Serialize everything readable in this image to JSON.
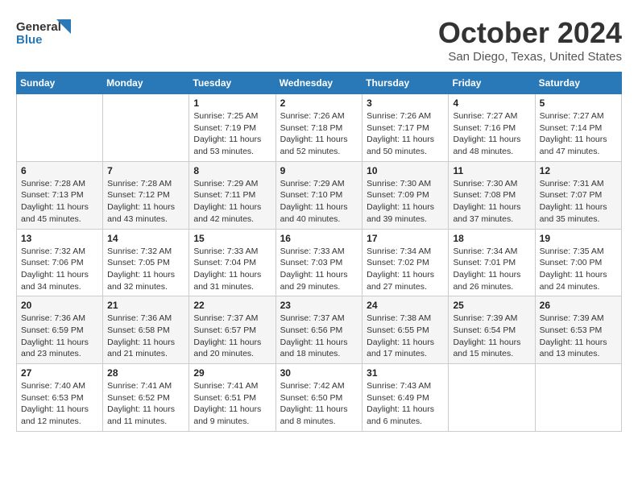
{
  "logo": {
    "line1": "General",
    "line2": "Blue"
  },
  "title": "October 2024",
  "location": "San Diego, Texas, United States",
  "days_of_week": [
    "Sunday",
    "Monday",
    "Tuesday",
    "Wednesday",
    "Thursday",
    "Friday",
    "Saturday"
  ],
  "weeks": [
    [
      {
        "day": "",
        "info": ""
      },
      {
        "day": "",
        "info": ""
      },
      {
        "day": "1",
        "info": "Sunrise: 7:25 AM\nSunset: 7:19 PM\nDaylight: 11 hours and 53 minutes."
      },
      {
        "day": "2",
        "info": "Sunrise: 7:26 AM\nSunset: 7:18 PM\nDaylight: 11 hours and 52 minutes."
      },
      {
        "day": "3",
        "info": "Sunrise: 7:26 AM\nSunset: 7:17 PM\nDaylight: 11 hours and 50 minutes."
      },
      {
        "day": "4",
        "info": "Sunrise: 7:27 AM\nSunset: 7:16 PM\nDaylight: 11 hours and 48 minutes."
      },
      {
        "day": "5",
        "info": "Sunrise: 7:27 AM\nSunset: 7:14 PM\nDaylight: 11 hours and 47 minutes."
      }
    ],
    [
      {
        "day": "6",
        "info": "Sunrise: 7:28 AM\nSunset: 7:13 PM\nDaylight: 11 hours and 45 minutes."
      },
      {
        "day": "7",
        "info": "Sunrise: 7:28 AM\nSunset: 7:12 PM\nDaylight: 11 hours and 43 minutes."
      },
      {
        "day": "8",
        "info": "Sunrise: 7:29 AM\nSunset: 7:11 PM\nDaylight: 11 hours and 42 minutes."
      },
      {
        "day": "9",
        "info": "Sunrise: 7:29 AM\nSunset: 7:10 PM\nDaylight: 11 hours and 40 minutes."
      },
      {
        "day": "10",
        "info": "Sunrise: 7:30 AM\nSunset: 7:09 PM\nDaylight: 11 hours and 39 minutes."
      },
      {
        "day": "11",
        "info": "Sunrise: 7:30 AM\nSunset: 7:08 PM\nDaylight: 11 hours and 37 minutes."
      },
      {
        "day": "12",
        "info": "Sunrise: 7:31 AM\nSunset: 7:07 PM\nDaylight: 11 hours and 35 minutes."
      }
    ],
    [
      {
        "day": "13",
        "info": "Sunrise: 7:32 AM\nSunset: 7:06 PM\nDaylight: 11 hours and 34 minutes."
      },
      {
        "day": "14",
        "info": "Sunrise: 7:32 AM\nSunset: 7:05 PM\nDaylight: 11 hours and 32 minutes."
      },
      {
        "day": "15",
        "info": "Sunrise: 7:33 AM\nSunset: 7:04 PM\nDaylight: 11 hours and 31 minutes."
      },
      {
        "day": "16",
        "info": "Sunrise: 7:33 AM\nSunset: 7:03 PM\nDaylight: 11 hours and 29 minutes."
      },
      {
        "day": "17",
        "info": "Sunrise: 7:34 AM\nSunset: 7:02 PM\nDaylight: 11 hours and 27 minutes."
      },
      {
        "day": "18",
        "info": "Sunrise: 7:34 AM\nSunset: 7:01 PM\nDaylight: 11 hours and 26 minutes."
      },
      {
        "day": "19",
        "info": "Sunrise: 7:35 AM\nSunset: 7:00 PM\nDaylight: 11 hours and 24 minutes."
      }
    ],
    [
      {
        "day": "20",
        "info": "Sunrise: 7:36 AM\nSunset: 6:59 PM\nDaylight: 11 hours and 23 minutes."
      },
      {
        "day": "21",
        "info": "Sunrise: 7:36 AM\nSunset: 6:58 PM\nDaylight: 11 hours and 21 minutes."
      },
      {
        "day": "22",
        "info": "Sunrise: 7:37 AM\nSunset: 6:57 PM\nDaylight: 11 hours and 20 minutes."
      },
      {
        "day": "23",
        "info": "Sunrise: 7:37 AM\nSunset: 6:56 PM\nDaylight: 11 hours and 18 minutes."
      },
      {
        "day": "24",
        "info": "Sunrise: 7:38 AM\nSunset: 6:55 PM\nDaylight: 11 hours and 17 minutes."
      },
      {
        "day": "25",
        "info": "Sunrise: 7:39 AM\nSunset: 6:54 PM\nDaylight: 11 hours and 15 minutes."
      },
      {
        "day": "26",
        "info": "Sunrise: 7:39 AM\nSunset: 6:53 PM\nDaylight: 11 hours and 13 minutes."
      }
    ],
    [
      {
        "day": "27",
        "info": "Sunrise: 7:40 AM\nSunset: 6:53 PM\nDaylight: 11 hours and 12 minutes."
      },
      {
        "day": "28",
        "info": "Sunrise: 7:41 AM\nSunset: 6:52 PM\nDaylight: 11 hours and 11 minutes."
      },
      {
        "day": "29",
        "info": "Sunrise: 7:41 AM\nSunset: 6:51 PM\nDaylight: 11 hours and 9 minutes."
      },
      {
        "day": "30",
        "info": "Sunrise: 7:42 AM\nSunset: 6:50 PM\nDaylight: 11 hours and 8 minutes."
      },
      {
        "day": "31",
        "info": "Sunrise: 7:43 AM\nSunset: 6:49 PM\nDaylight: 11 hours and 6 minutes."
      },
      {
        "day": "",
        "info": ""
      },
      {
        "day": "",
        "info": ""
      }
    ]
  ]
}
